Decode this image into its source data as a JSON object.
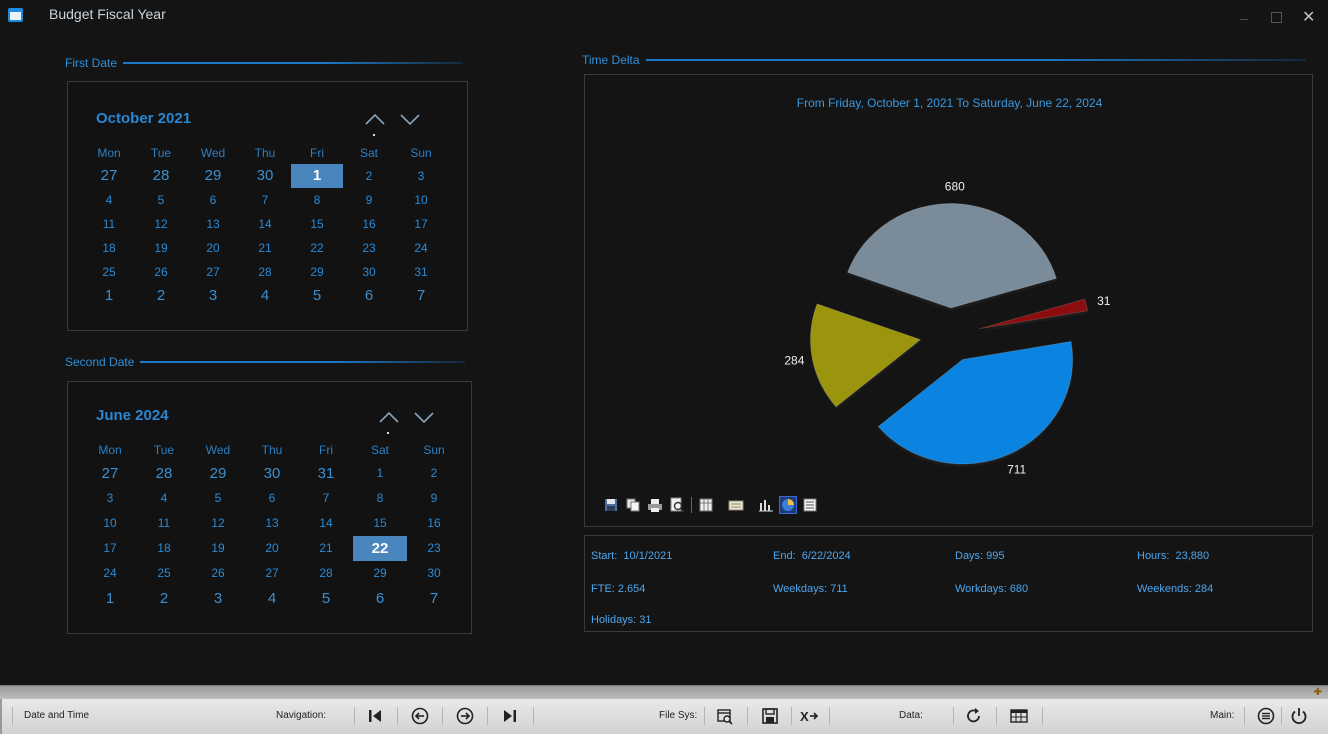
{
  "window": {
    "title": "Budget Fiscal Year",
    "minimize_glyph": "_",
    "close_glyph": "✕"
  },
  "first_date": {
    "group_title": "First Date",
    "month_year": "October  2021",
    "weekdays": [
      "Mon",
      "Tue",
      "Wed",
      "Thu",
      "Fri",
      "Sat",
      "Sun"
    ],
    "weeks": [
      [
        "27",
        "28",
        "29",
        "30",
        "1",
        "2",
        "3"
      ],
      [
        "4",
        "5",
        "6",
        "7",
        "8",
        "9",
        "10"
      ],
      [
        "11",
        "12",
        "13",
        "14",
        "15",
        "16",
        "17"
      ],
      [
        "18",
        "19",
        "20",
        "21",
        "22",
        "23",
        "24"
      ],
      [
        "25",
        "26",
        "27",
        "28",
        "29",
        "30",
        "31"
      ],
      [
        "1",
        "2",
        "3",
        "4",
        "5",
        "6",
        "7"
      ]
    ],
    "selected": "1"
  },
  "second_date": {
    "group_title": "Second Date",
    "month_year": "June  2024",
    "weekdays": [
      "Mon",
      "Tue",
      "Wed",
      "Thu",
      "Fri",
      "Sat",
      "Sun"
    ],
    "weeks": [
      [
        "27",
        "28",
        "29",
        "30",
        "31",
        "1",
        "2"
      ],
      [
        "3",
        "4",
        "5",
        "6",
        "7",
        "8",
        "9"
      ],
      [
        "10",
        "11",
        "12",
        "13",
        "14",
        "15",
        "16"
      ],
      [
        "17",
        "18",
        "19",
        "20",
        "21",
        "22",
        "23"
      ],
      [
        "24",
        "25",
        "26",
        "27",
        "28",
        "29",
        "30"
      ],
      [
        "1",
        "2",
        "3",
        "4",
        "5",
        "6",
        "7"
      ]
    ],
    "selected": "22"
  },
  "time_delta": {
    "group_title": "Time Delta",
    "chart_title": "From Friday, October 1, 2021 To Saturday, June 22, 2024"
  },
  "chart_data": {
    "type": "pie",
    "title": "From Friday, October 1, 2021 To Saturday, June 22, 2024",
    "slices": [
      {
        "value": 680,
        "label": "680",
        "color": "#7a8b99"
      },
      {
        "value": 31,
        "label": "31",
        "color": "#8b0d0d"
      },
      {
        "value": 711,
        "label": "711",
        "color": "#0a84e0"
      },
      {
        "value": 284,
        "label": "284",
        "color": "#9a950c"
      }
    ],
    "exploded": true
  },
  "chart_toolbar": [
    "save-icon",
    "copy-icon",
    "print-icon",
    "print-preview-icon",
    "data-grid-icon",
    "legend-icon",
    "bar-chart-icon",
    "pie-chart-icon",
    "list-icon"
  ],
  "stats": {
    "start": "Start:  10/1/2021",
    "end": "End:  6/22/2024",
    "days": "Days: 995",
    "hours": "Hours:  23,880",
    "fte": "FTE: 2.654",
    "weekdays": "Weekdays: 711",
    "workdays": "Workdays: 680",
    "weekends": "Weekends: 284",
    "holidays": "Holidays: 31"
  },
  "statusbar": {
    "section_title": "Date and Time",
    "navigation_label": "Navigation:",
    "filesys_label": "File Sys:",
    "data_label": "Data:",
    "main_label": "Main:"
  },
  "colors": {
    "accent": "#2a8ad6",
    "selected_day": "#4a86be",
    "background": "#141414"
  }
}
